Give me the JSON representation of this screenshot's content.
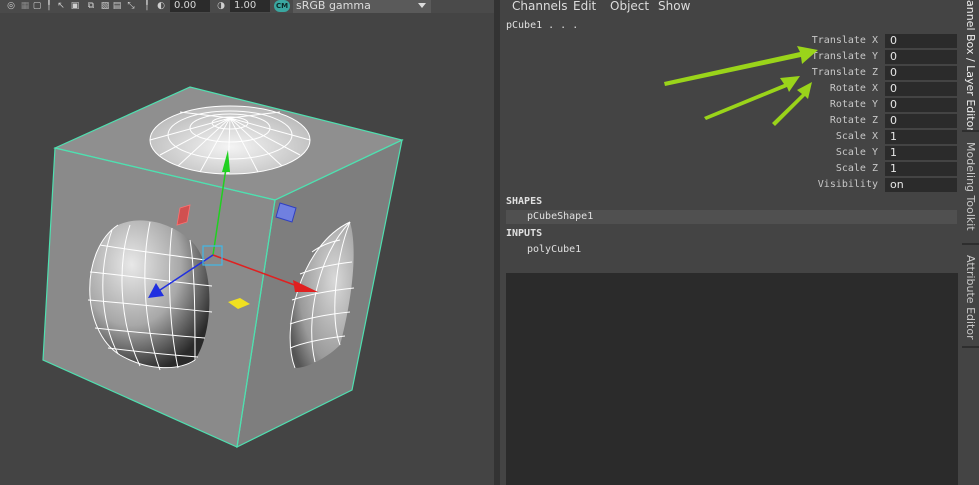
{
  "toolbar": {
    "field1_value": "0.00",
    "field2_value": "1.00",
    "colorspace_badge": "CM",
    "colorspace_select": "sRGB gamma",
    "colors": {
      "accent": "#3aa7a0"
    }
  },
  "menu": [
    "Channels",
    "Edit",
    "Object",
    "Show"
  ],
  "object_name": "pCube1 . . .",
  "channels": [
    {
      "label": "Translate X",
      "value": "0"
    },
    {
      "label": "Translate Y",
      "value": "0"
    },
    {
      "label": "Translate Z",
      "value": "0"
    },
    {
      "label": "Rotate X",
      "value": "0"
    },
    {
      "label": "Rotate Y",
      "value": "0"
    },
    {
      "label": "Rotate Z",
      "value": "0"
    },
    {
      "label": "Scale X",
      "value": "1"
    },
    {
      "label": "Scale Y",
      "value": "1"
    },
    {
      "label": "Scale Z",
      "value": "1"
    },
    {
      "label": "Visibility",
      "value": "on"
    }
  ],
  "shapes": {
    "heading": "SHAPES",
    "items": [
      "pCubeShape1"
    ]
  },
  "inputs": {
    "heading": "INPUTS",
    "items": [
      "polyCube1"
    ]
  },
  "side_tabs": [
    "annel Box / Layer Editor",
    "Modeling Toolkit",
    "Attribute Editor"
  ],
  "viewport": {
    "colors": {
      "wireframe": "#4fe0b0",
      "x_axis": "#e02020",
      "y_axis": "#20d020",
      "z_axis": "#2030e0",
      "annotation_arrow": "#9ad41a"
    }
  }
}
